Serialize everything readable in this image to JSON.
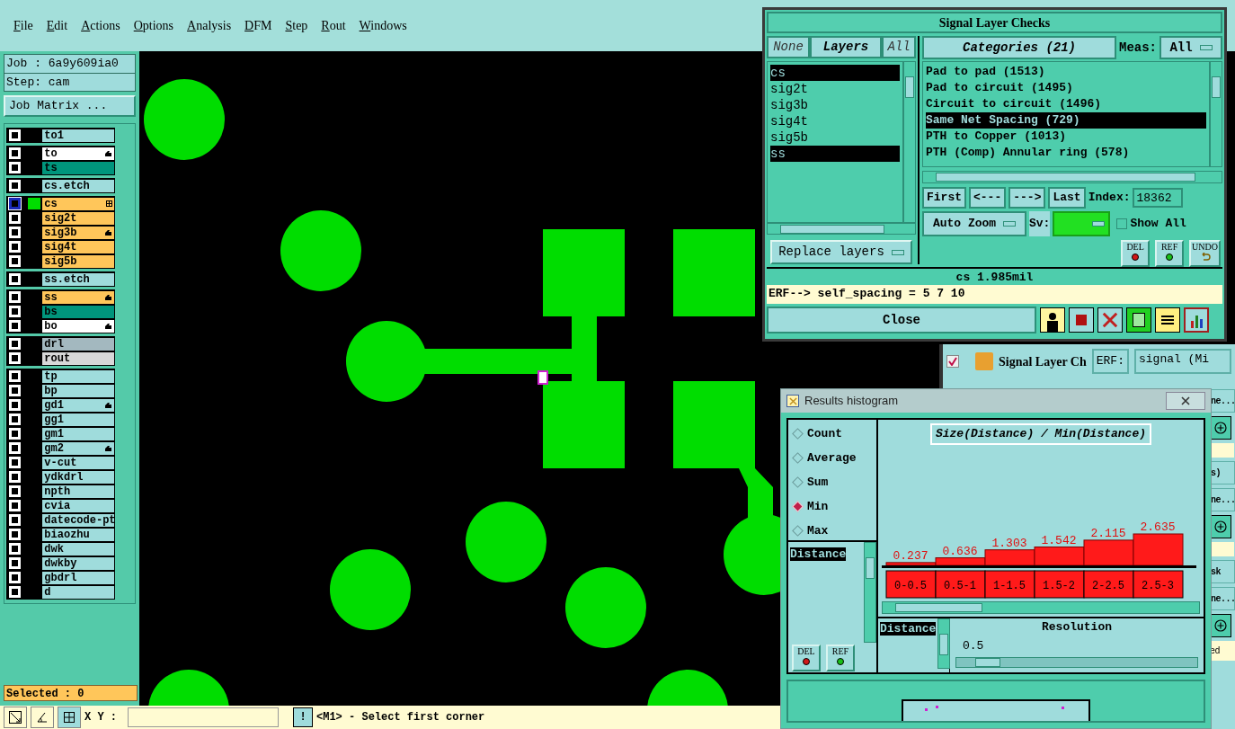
{
  "menu": [
    "File",
    "Edit",
    "Actions",
    "Options",
    "Analysis",
    "DFM",
    "Step",
    "Rout",
    "Windows"
  ],
  "job": {
    "job_label": "Job : 6a9y609ia0",
    "step_label": "Step: cam",
    "matrix_button": "Job Matrix ..."
  },
  "layer_groups": [
    {
      "layers": [
        {
          "name": "to1",
          "color": "#9fdcdc",
          "active": false,
          "affected": false
        }
      ]
    },
    {
      "layers": [
        {
          "name": "to",
          "color": "#ffffff",
          "active": false,
          "affected": true
        },
        {
          "name": "ts",
          "color": "#00957c",
          "active": false,
          "affected": false
        }
      ]
    },
    {
      "layers": [
        {
          "name": "cs.etch",
          "color": "#9fdcdc",
          "active": false,
          "affected": false
        }
      ]
    },
    {
      "layers": [
        {
          "name": "cs",
          "color": "#ffc65a",
          "active": true,
          "affected": false
        },
        {
          "name": "sig2t",
          "color": "#ffc65a",
          "active": false,
          "affected": false
        },
        {
          "name": "sig3b",
          "color": "#ffc65a",
          "active": false,
          "affected": true
        },
        {
          "name": "sig4t",
          "color": "#ffc65a",
          "active": false,
          "affected": false
        },
        {
          "name": "sig5b",
          "color": "#ffc65a",
          "active": false,
          "affected": false
        }
      ]
    },
    {
      "layers": [
        {
          "name": "ss.etch",
          "color": "#9fdcdc",
          "active": false,
          "affected": false
        }
      ]
    },
    {
      "layers": [
        {
          "name": "ss",
          "color": "#ffc65a",
          "active": false,
          "affected": true
        },
        {
          "name": "bs",
          "color": "#00957c",
          "active": false,
          "affected": false
        },
        {
          "name": "bo",
          "color": "#ffffff",
          "active": false,
          "affected": true
        }
      ]
    },
    {
      "layers": [
        {
          "name": "drl",
          "color": "#a3b8bf",
          "active": false,
          "affected": false
        },
        {
          "name": "rout",
          "color": "#d8d8d8",
          "active": false,
          "affected": false
        }
      ]
    },
    {
      "layers": [
        {
          "name": "tp",
          "color": "#9fdcdc",
          "active": false,
          "affected": false
        },
        {
          "name": "bp",
          "color": "#9fdcdc",
          "active": false,
          "affected": false
        },
        {
          "name": "gd1",
          "color": "#9fdcdc",
          "active": false,
          "affected": true
        },
        {
          "name": "gg1",
          "color": "#9fdcdc",
          "active": false,
          "affected": false
        },
        {
          "name": "gm1",
          "color": "#9fdcdc",
          "active": false,
          "affected": false
        },
        {
          "name": "gm2",
          "color": "#9fdcdc",
          "active": false,
          "affected": true
        },
        {
          "name": "v-cut",
          "color": "#9fdcdc",
          "active": false,
          "affected": false
        },
        {
          "name": "ydkdrl",
          "color": "#9fdcdc",
          "active": false,
          "affected": false
        },
        {
          "name": "npth",
          "color": "#9fdcdc",
          "active": false,
          "affected": false
        },
        {
          "name": "cvia",
          "color": "#9fdcdc",
          "active": false,
          "affected": false
        },
        {
          "name": "datecode-pt",
          "color": "#9fdcdc",
          "active": false,
          "affected": false
        },
        {
          "name": "biaozhu",
          "color": "#9fdcdc",
          "active": false,
          "affected": false
        },
        {
          "name": "dwk",
          "color": "#9fdcdc",
          "active": false,
          "affected": false
        },
        {
          "name": "dwkby",
          "color": "#9fdcdc",
          "active": false,
          "affected": false
        },
        {
          "name": "gbdrl",
          "color": "#9fdcdc",
          "active": false,
          "affected": false
        },
        {
          "name": "d",
          "color": "#9fdcdc",
          "active": false,
          "affected": false
        }
      ]
    }
  ],
  "selected_count": "Selected : 0",
  "bottom_bar": {
    "xy_label": "X Y :",
    "alert_button": "!",
    "message": "<M1> - Select first corner"
  },
  "checks_window": {
    "title": "Signal Layer Checks",
    "none_button": "None",
    "layers_button": "Layers",
    "all_button": "All",
    "layers": [
      {
        "name": "cs",
        "selected": true
      },
      {
        "name": "sig2t",
        "selected": false
      },
      {
        "name": "sig3b",
        "selected": false
      },
      {
        "name": "sig4t",
        "selected": false
      },
      {
        "name": "sig5b",
        "selected": false
      },
      {
        "name": "ss",
        "selected": true
      }
    ],
    "categories_header": "Categories (21)",
    "meas_label": "Meas:",
    "meas_value": "All",
    "categories": [
      {
        "label": "Pad to pad (1513)",
        "selected": false
      },
      {
        "label": "Pad to circuit (1495)",
        "selected": false
      },
      {
        "label": "Circuit to circuit (1496)",
        "selected": false
      },
      {
        "label": "Same Net Spacing (729)",
        "selected": true
      },
      {
        "label": "PTH to Copper (1013)",
        "selected": false
      },
      {
        "label": "PTH (Comp) Annular ring (578)",
        "selected": false
      }
    ],
    "nav_buttons": [
      "First",
      "<---",
      "--->",
      "Last"
    ],
    "index_label": "Index:",
    "index_value": "18362",
    "zoom_dropdown": "Auto Zoom",
    "sv_label": "Sv:",
    "show_all": {
      "label": "Show All",
      "checked": false
    },
    "replace_dropdown": "Replace layers",
    "action_buttons": [
      {
        "label": "DEL",
        "kind": "del"
      },
      {
        "label": "REF",
        "kind": "ref"
      },
      {
        "label": "UNDO",
        "kind": "undo"
      }
    ],
    "status": "cs 1.985mil",
    "erf_line": "ERF--> self_spacing = 5 7 10",
    "close_button": "Close"
  },
  "background_window": {
    "checked": true,
    "title": "Signal Layer Ch",
    "erf_button": "ERF:",
    "erf_value": "signal (Mi",
    "side_items": [
      {
        "kind": "text",
        "text": "ne..."
      },
      {
        "kind": "plus"
      },
      {
        "kind": "band"
      },
      {
        "kind": "text",
        "text": "s)"
      },
      {
        "kind": "text",
        "text": "ne..."
      },
      {
        "kind": "plus"
      },
      {
        "kind": "band"
      },
      {
        "kind": "text",
        "text": "sk"
      },
      {
        "kind": "text",
        "text": "ne..."
      },
      {
        "kind": "plus"
      },
      {
        "kind": "field",
        "text": "ed"
      }
    ]
  },
  "histogram_window": {
    "title": "Results histogram",
    "modes": [
      {
        "label": "Count",
        "selected": false
      },
      {
        "label": "Average",
        "selected": false
      },
      {
        "label": "Sum",
        "selected": false
      },
      {
        "label": "Min",
        "selected": true
      },
      {
        "label": "Max",
        "selected": false
      }
    ],
    "list_item": {
      "label": "Distance",
      "selected": true
    },
    "del_button": "DEL",
    "ref_button": "REF",
    "chart_data": {
      "type": "bar",
      "title": "Size(Distance) / Min(Distance)",
      "categories": [
        "0-0.5",
        "0.5-1",
        "1-1.5",
        "1.5-2",
        "2-2.5",
        "2.5-3"
      ],
      "values": [
        0.237,
        0.636,
        1.303,
        1.542,
        2.115,
        2.635
      ],
      "data_labels": true
    },
    "bottom_list_item": {
      "label": "Distance",
      "selected": true
    },
    "resolution": {
      "label": "Resolution",
      "value": "0.5",
      "level": 0.08
    }
  }
}
